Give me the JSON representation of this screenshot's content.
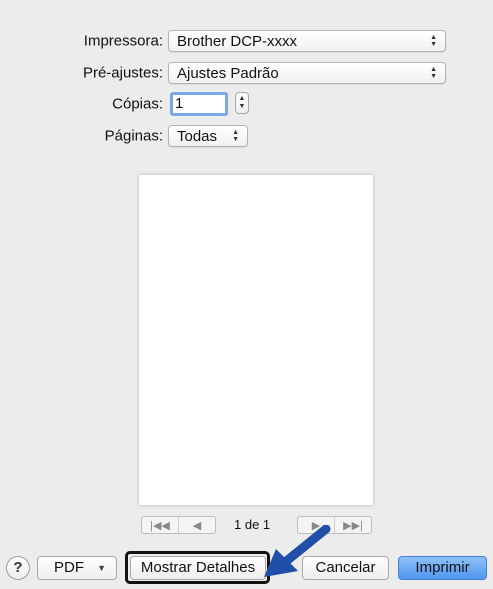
{
  "form": {
    "printer": {
      "label": "Impressora:",
      "value": "Brother DCP-xxxx"
    },
    "presets": {
      "label": "Pré-ajustes:",
      "value": "Ajustes Padrão"
    },
    "copies": {
      "label": "Cópias:",
      "value": "1"
    },
    "pages": {
      "label": "Páginas:",
      "value": "Todas"
    }
  },
  "preview": {
    "page_indicator": "1 de 1"
  },
  "footer": {
    "help_label": "?",
    "pdf_label": "PDF",
    "details_label": "Mostrar Detalhes",
    "cancel_label": "Cancelar",
    "print_label": "Imprimir"
  },
  "colors": {
    "accent": "#4f97ef",
    "annotation_arrow": "#1f4fa8",
    "background": "#ececec"
  }
}
